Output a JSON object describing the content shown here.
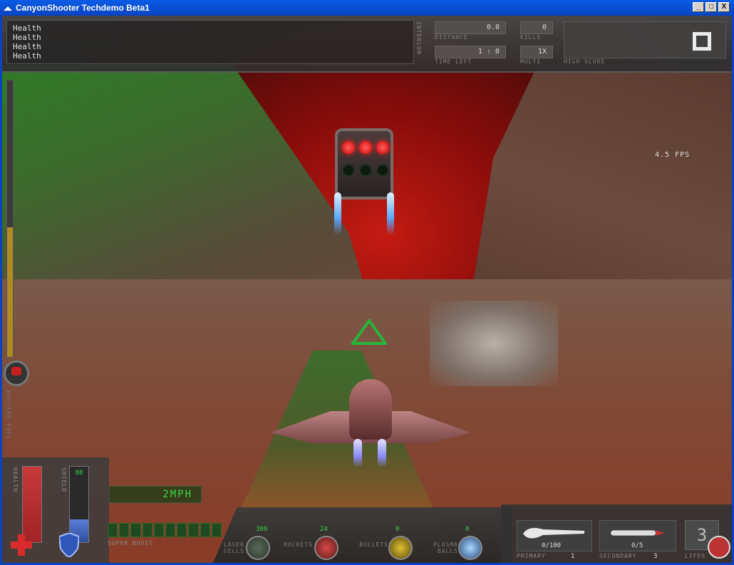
{
  "window": {
    "title": "CanyonShooter Techdemo Beta1",
    "minimize": "_",
    "maximize": "□",
    "close": "X"
  },
  "hud": {
    "intercom_label": "INTERCOM",
    "intercom_lines": [
      "Health",
      "Health",
      "Health",
      "Health"
    ],
    "distance_value": "0.0",
    "distance_label": "DISTANCE",
    "kills_value": "0",
    "kills_label": "KILLS",
    "time_left_value": "1 : 0",
    "time_left_label": "TIME LEFT",
    "multi_value": "1X",
    "multi_label": "MULTI",
    "high_score_label": "HIGH SCORE",
    "fps": "4.5 FPS",
    "booster_label": "BOOSTER FUEL",
    "booster_level": 0.47,
    "health_label": "HEALTH",
    "health_level": 1.0,
    "shield_label": "SHIELD",
    "shield_value": "80",
    "shield_level": 0.3,
    "speed": "2MPH",
    "super_boost_label": "SUPER BOOST"
  },
  "weapons": {
    "laser_label": "LASER CELLS",
    "laser_count": "300",
    "rockets_label": "ROCKETS",
    "rockets_count": "24",
    "bullets_label": "BULLETS",
    "bullets_count": "0",
    "plasma_label": "PLASMA BALLS",
    "plasma_count": "0"
  },
  "slots": {
    "primary_ammo": "0/100",
    "primary_label": "PRIMARY",
    "primary_index": "1",
    "secondary_ammo": "0/5",
    "secondary_label": "SECONDARY",
    "secondary_index": "3",
    "lifes_value": "3",
    "lifes_label": "LIFES"
  },
  "colors": {
    "accent_green": "#39d64b",
    "health_red": "#c8383a",
    "shield_blue": "#3a5fb8"
  }
}
